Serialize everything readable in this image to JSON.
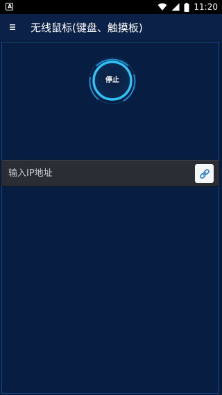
{
  "status_bar": {
    "notification_badge": "A",
    "time": "11:20"
  },
  "app_bar": {
    "title": "无线鼠标(键盘、触摸板)"
  },
  "main": {
    "stop_button_label": "停止",
    "ip_input": {
      "placeholder": "输入IP地址",
      "value": ""
    }
  },
  "icons": {
    "menu": "hamburger-menu-icon",
    "link": "link-icon",
    "wifi": "wifi-icon",
    "signal": "signal-icon",
    "battery": "battery-icon"
  },
  "colors": {
    "background": "#071c3d",
    "app_bar": "#0b2147",
    "accent": "#2fc3f5",
    "input_row": "#2a2d33"
  }
}
